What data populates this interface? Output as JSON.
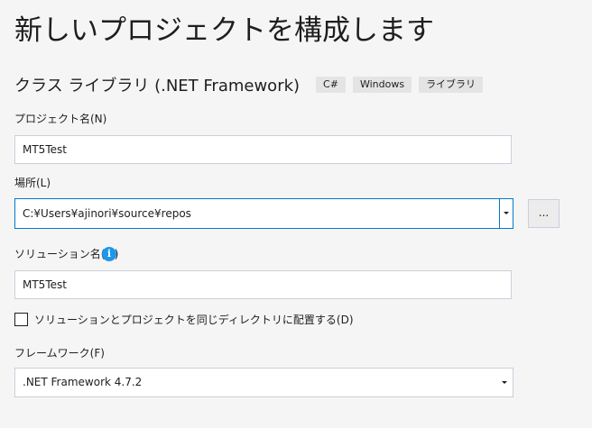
{
  "page": {
    "title": "新しいプロジェクトを構成します"
  },
  "template": {
    "name": "クラス ライブラリ (.NET Framework)",
    "tags": [
      "C#",
      "Windows",
      "ライブラリ"
    ]
  },
  "project_name": {
    "label": "プロジェクト名(N)",
    "value": "MT5Test"
  },
  "location": {
    "label": "場所(L)",
    "value": "C:¥Users¥ajinori¥source¥repos",
    "browse_label": "..."
  },
  "solution_name": {
    "label": "ソリューション名(M)",
    "info_icon": "info-icon",
    "value": "MT5Test"
  },
  "same_directory": {
    "label": "ソリューションとプロジェクトを同じディレクトリに配置する(D)",
    "checked": false
  },
  "framework": {
    "label": "フレームワーク(F)",
    "value": ".NET Framework 4.7.2"
  },
  "colors": {
    "accent": "#007acc",
    "info": "#1c97ea",
    "background": "#f5f5f5"
  }
}
